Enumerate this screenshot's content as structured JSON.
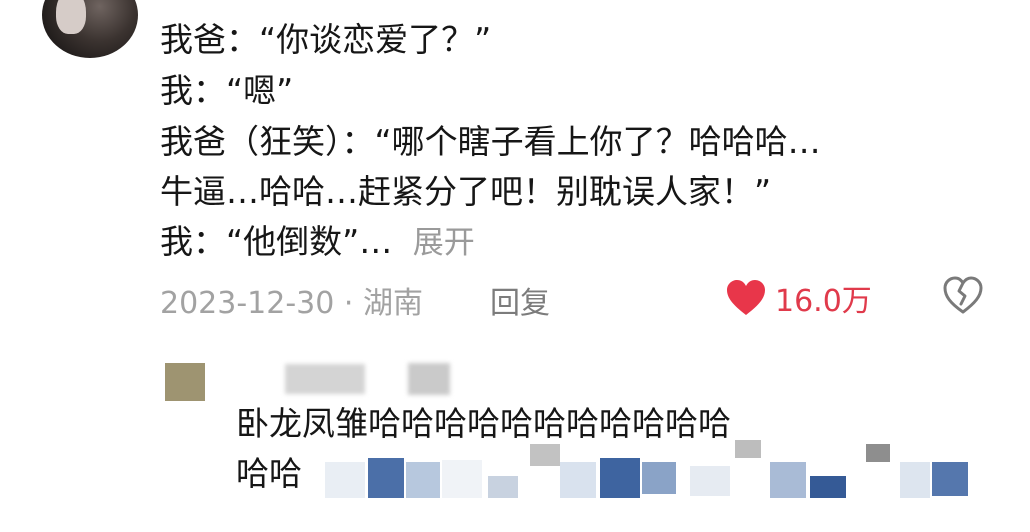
{
  "comment": {
    "lines": [
      "我爸：“你谈恋爱了？”",
      "我：“嗯”",
      "我爸（狂笑）：“哪个瞎子看上你了？哈哈哈…",
      "牛逼…哈哈…赶紧分了吧！别耽误人家！”",
      "我：“他倒数”…"
    ],
    "expand_label": "展开",
    "date_location": "2023-12-30 · 湖南",
    "reply_label": "回复",
    "like_count": "16.0万",
    "colors": {
      "like": "#e8364a",
      "secondary_text": "#a2a2a2"
    }
  },
  "reply": {
    "lines": [
      "卧龙凤雏哈哈哈哈哈哈哈哈哈哈哈",
      "哈哈"
    ]
  },
  "icons": {
    "like": "heart-icon",
    "dislike": "broken-heart-icon"
  }
}
